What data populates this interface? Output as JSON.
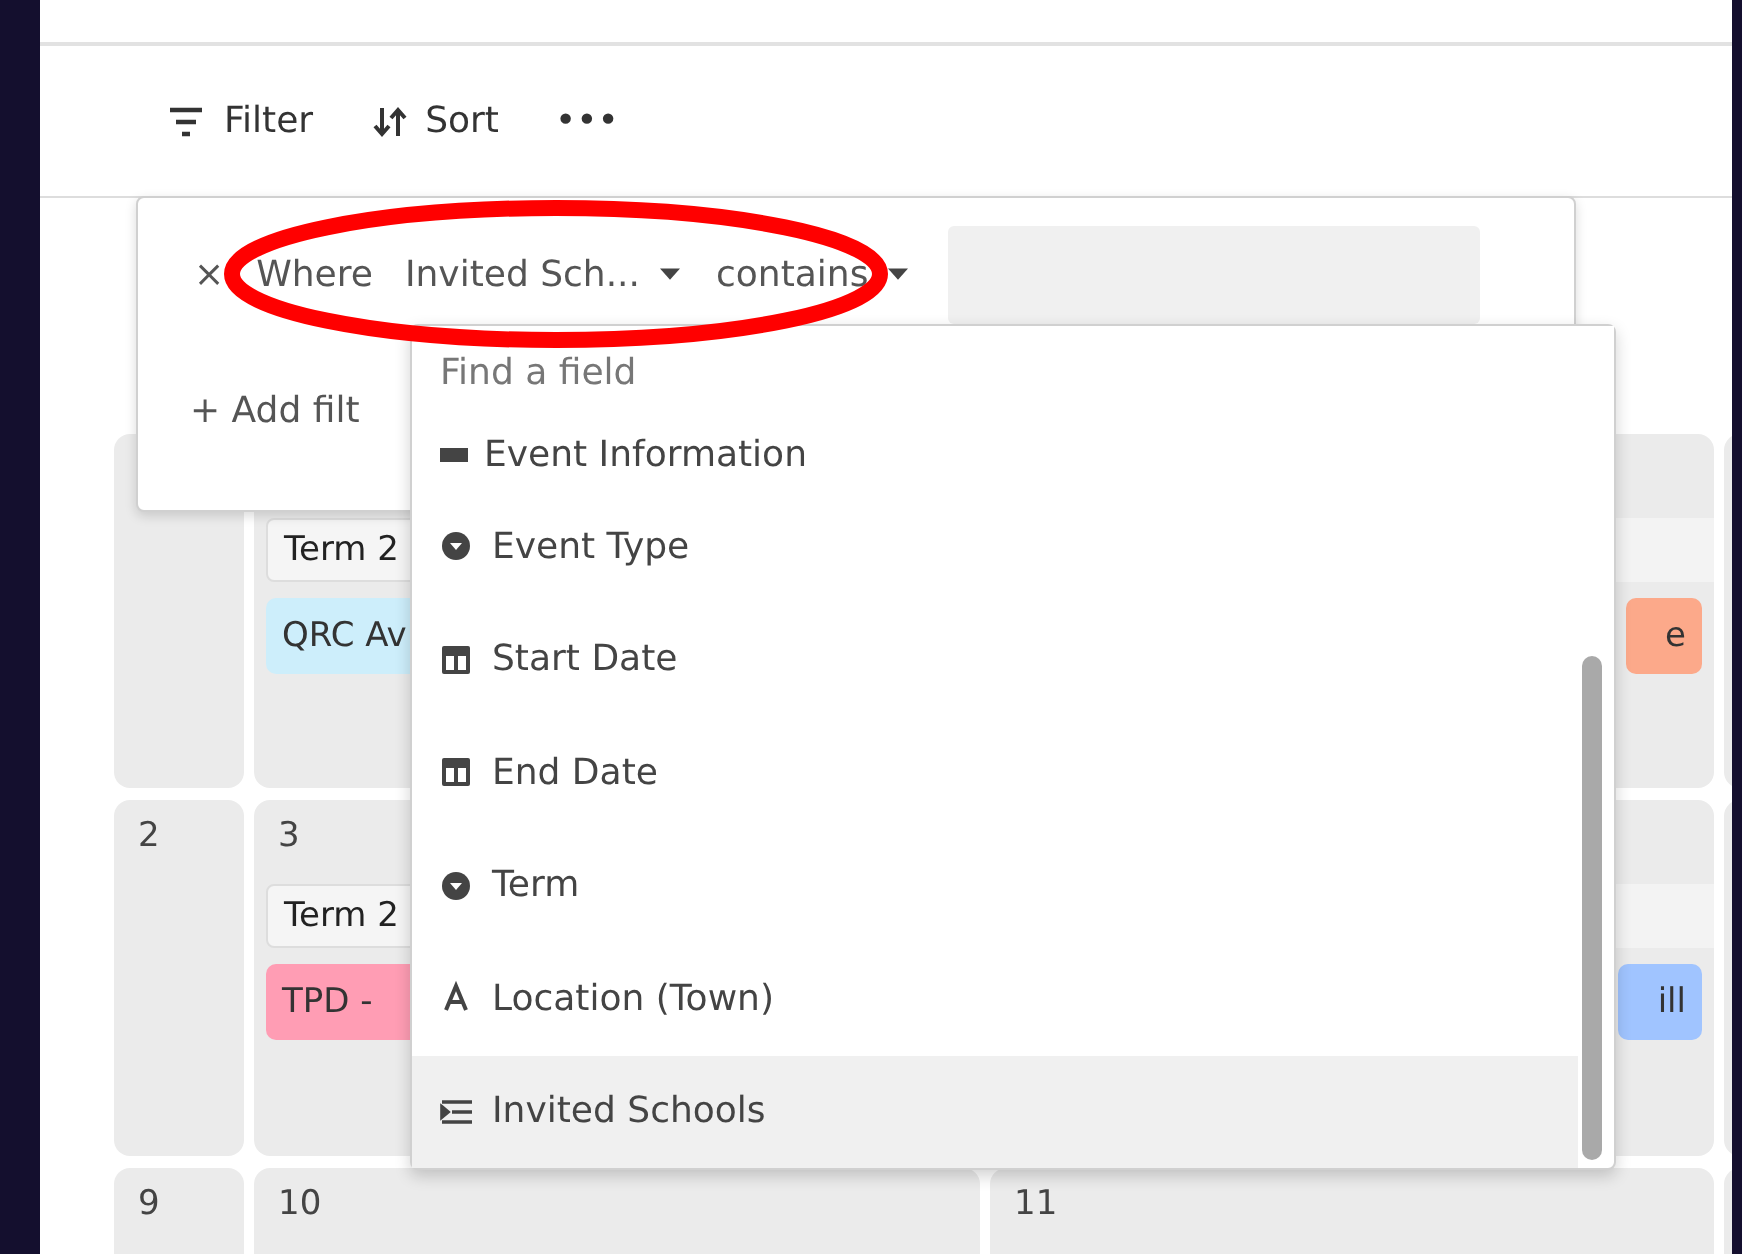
{
  "toolbar": {
    "buttons": [
      {
        "kind": "filter",
        "label": "Filter"
      },
      {
        "kind": "sort",
        "label": "Sort"
      },
      {
        "kind": "more",
        "label": "•••"
      }
    ]
  },
  "calendar": {
    "rows": [
      {
        "days": [
          {
            "chips": [
              {
                "kind": "term",
                "label": "Term 2"
              },
              {
                "kind": "event",
                "label": "QRC Av",
                "color": "#cdeefb"
              }
            ]
          },
          {
            "chips": [
              {
                "kind": "term_continued"
              },
              {
                "kind": "event",
                "label": "e",
                "color": "#fca98a"
              }
            ]
          }
        ]
      },
      {
        "week": "2",
        "days": [
          {
            "date": "3",
            "chips": [
              {
                "kind": "term",
                "label": "Term 2"
              },
              {
                "kind": "event",
                "label": "TPD -",
                "color": "#ff9db4"
              }
            ]
          },
          {
            "chips": [
              {
                "kind": "term_continued"
              },
              {
                "kind": "event",
                "label": "ill",
                "color": "#a0c4ff"
              }
            ]
          }
        ]
      },
      {
        "week": "9",
        "days": [
          {
            "date": "10"
          },
          {
            "date": "11"
          }
        ]
      }
    ]
  },
  "filter_popover": {
    "remove": "×",
    "where": "Where",
    "field": "Invited Sch...",
    "operator": "contains",
    "add_filter": "+ Add filt"
  },
  "field_menu": {
    "placeholder": "Find a field",
    "items": [
      {
        "kind": "section",
        "label": "Event Information",
        "selected": false
      },
      {
        "kind": "select",
        "label": "Event Type",
        "selected": false
      },
      {
        "kind": "date",
        "label": "Start Date",
        "selected": false
      },
      {
        "kind": "date",
        "label": "End Date",
        "selected": false
      },
      {
        "kind": "select",
        "label": "Term",
        "selected": false
      },
      {
        "kind": "text",
        "label": "Location (Town)",
        "selected": false
      },
      {
        "kind": "link",
        "label": "Invited Schools",
        "selected": true
      }
    ]
  }
}
